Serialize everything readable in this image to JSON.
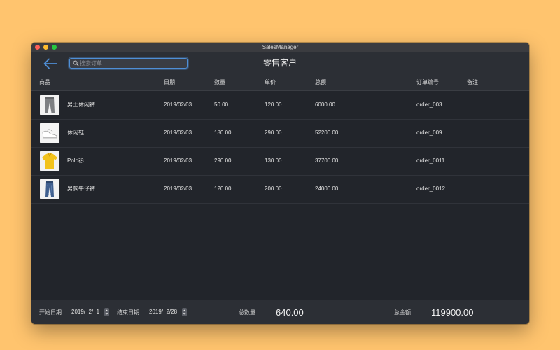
{
  "window": {
    "title": "SalesManager"
  },
  "toolbar": {
    "search_placeholder": "搜索订单",
    "search_value": "",
    "page_title": "零售客户"
  },
  "table": {
    "columns": {
      "product": "商品",
      "date": "日期",
      "quantity": "数量",
      "unit_price": "单价",
      "total": "总额",
      "order_no": "订单编号",
      "note": "备注"
    },
    "rows": [
      {
        "image_icon": "pants-icon",
        "product": "男士休闲裤",
        "date": "2019/02/03",
        "quantity": "50.00",
        "unit_price": "120.00",
        "total": "6000.00",
        "order_no": "order_003",
        "note": ""
      },
      {
        "image_icon": "shoe-icon",
        "product": "休闲鞋",
        "date": "2019/02/03",
        "quantity": "180.00",
        "unit_price": "290.00",
        "total": "52200.00",
        "order_no": "order_009",
        "note": ""
      },
      {
        "image_icon": "polo-shirt-icon",
        "product": "Polo衫",
        "date": "2019/02/03",
        "quantity": "290.00",
        "unit_price": "130.00",
        "total": "37700.00",
        "order_no": "order_0011",
        "note": ""
      },
      {
        "image_icon": "jeans-icon",
        "product": "男款牛仔裤",
        "date": "2019/02/03",
        "quantity": "120.00",
        "unit_price": "200.00",
        "total": "24000.00",
        "order_no": "order_0012",
        "note": ""
      }
    ]
  },
  "footer": {
    "start_date_label": "开始日期",
    "start_date_value": "2019/  2/  1",
    "end_date_label": "结束日期",
    "end_date_value": "2019/  2/28",
    "total_quantity_label": "总数量",
    "total_quantity_value": "640.00",
    "total_amount_label": "总金额",
    "total_amount_value": "119900.00"
  },
  "colors": {
    "accent": "#4f8fd6",
    "background": "#ffc46e",
    "window_bg": "#22252b",
    "toolbar_bg": "#2c2f35"
  }
}
